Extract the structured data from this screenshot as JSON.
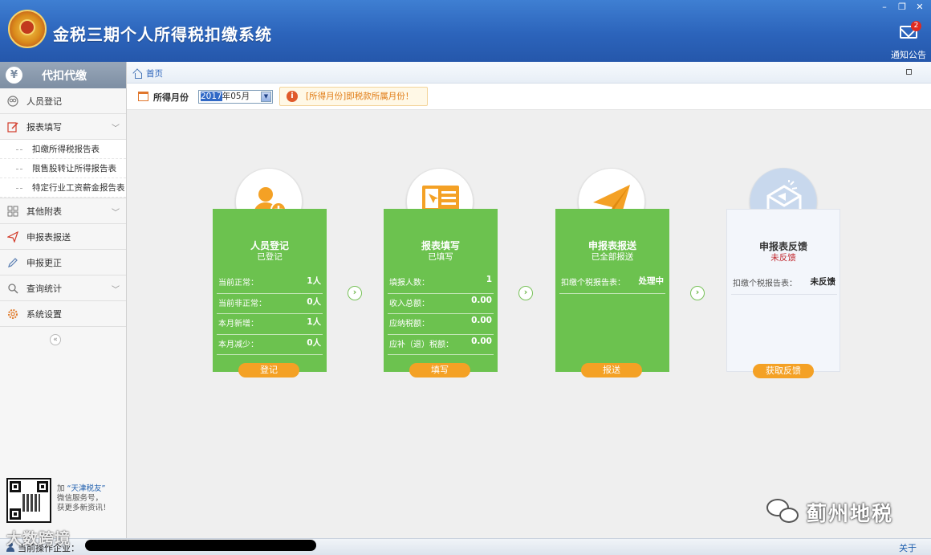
{
  "header": {
    "title": "金税三期个人所得税扣缴系统",
    "notice_label": "通知公告",
    "notice_count": "2"
  },
  "window_controls": {
    "minimize": "–",
    "restore": "❐",
    "close": "✕"
  },
  "sidebar": {
    "heading": "代扣代缴",
    "heading_icon": "¥",
    "items": [
      {
        "label": "人员登记",
        "icon": "person-icon"
      },
      {
        "label": "报表填写",
        "icon": "form-edit-icon"
      },
      {
        "label": "其他附表",
        "icon": "grid-icon"
      },
      {
        "label": "申报表报送",
        "icon": "send-icon"
      },
      {
        "label": "申报更正",
        "icon": "pencil-icon"
      },
      {
        "label": "查询统计",
        "icon": "search-icon"
      },
      {
        "label": "系统设置",
        "icon": "gear-icon"
      }
    ],
    "sub_items": [
      "扣缴所得税报告表",
      "限售股转让所得报告表",
      "特定行业工资薪金报告表"
    ],
    "collapse": "«",
    "qr": {
      "line1_prefix": "加",
      "line1_highlight": "“天津税友”",
      "line2": "微信服务号，",
      "line3": "获更多新资讯！"
    }
  },
  "breadcrumb": {
    "home": "首页"
  },
  "filter": {
    "label": "所得月份",
    "year_selected": "2017",
    "month_suffix": "年05月",
    "tip": "[所得月份]即税款所属月份！",
    "tip_icon": "i"
  },
  "cards": [
    {
      "title": "人员登记",
      "status": "已登记",
      "button": "登记",
      "rows": [
        {
          "k": "当前正常：",
          "v": "1人"
        },
        {
          "k": "当前非正常：",
          "v": "0人"
        },
        {
          "k": "本月新增：",
          "v": "1人"
        },
        {
          "k": "本月减少：",
          "v": "0人"
        }
      ]
    },
    {
      "title": "报表填写",
      "status": "已填写",
      "button": "填写",
      "rows": [
        {
          "k": "填报人数：",
          "v": "1"
        },
        {
          "k": "收入总额：",
          "v": "0.00"
        },
        {
          "k": "应纳税额：",
          "v": "0.00"
        },
        {
          "k": "应补（退）税额：",
          "v": "0.00"
        }
      ]
    },
    {
      "title": "申报表报送",
      "status": "已全部报送",
      "button": "报送",
      "rows": [
        {
          "k": "扣缴个税报告表：",
          "v": "处理中"
        }
      ]
    },
    {
      "title": "申报表反馈",
      "status": "未反馈",
      "button": "获取反馈",
      "rows": [
        {
          "k": "扣缴个税报告表：",
          "v": "未反馈"
        }
      ]
    }
  ],
  "flow_arrow": "›",
  "status_bar": {
    "label": "当前操作企业：",
    "about": "关于"
  },
  "watermarks": {
    "left": "大数跨境",
    "right": "蓟州地税"
  },
  "colors": {
    "header": "#2c64bb",
    "card_green": "#6cc24f",
    "button_orange": "#f4a125",
    "tip_orange": "#e07b14"
  }
}
